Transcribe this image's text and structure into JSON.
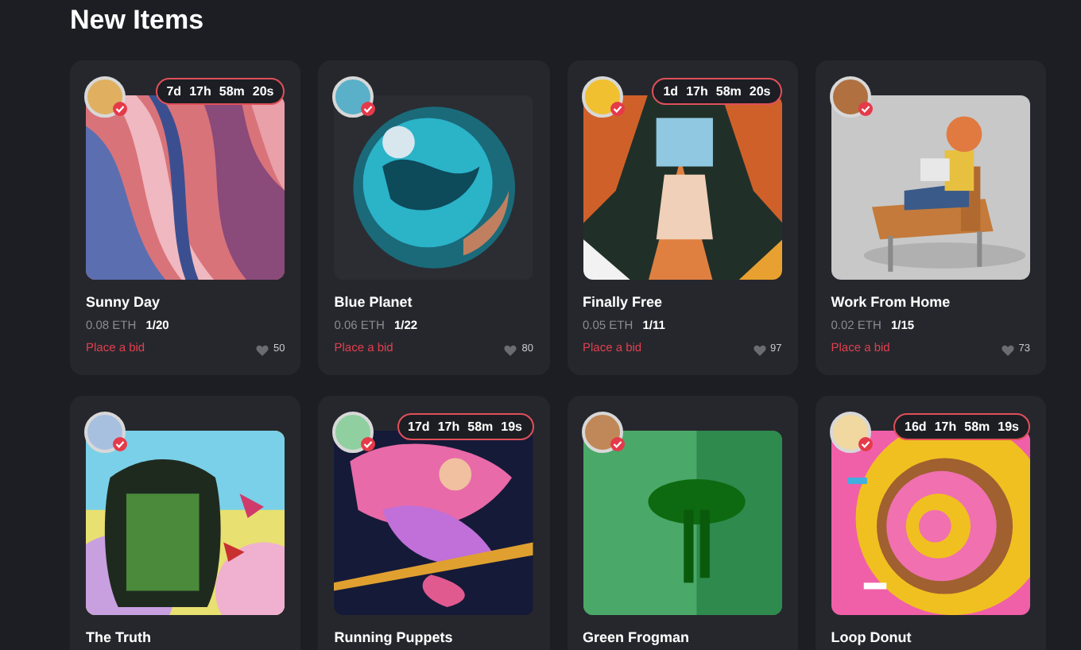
{
  "heading": "New Items",
  "items": [
    {
      "title": "Sunny Day",
      "timer": [
        "7d",
        "17h",
        "58m",
        "20s"
      ],
      "price": "0.08 ETH",
      "edition": "1/20",
      "action": "Place a bid",
      "likes": "50"
    },
    {
      "title": "Blue Planet",
      "price": "0.06 ETH",
      "edition": "1/22",
      "action": "Place a bid",
      "likes": "80"
    },
    {
      "title": "Finally Free",
      "timer": [
        "1d",
        "17h",
        "58m",
        "20s"
      ],
      "price": "0.05 ETH",
      "edition": "1/11",
      "action": "Place a bid",
      "likes": "97"
    },
    {
      "title": "Work From Home",
      "price": "0.02 ETH",
      "edition": "1/15",
      "action": "Place a bid",
      "likes": "73"
    },
    {
      "title": "The Truth"
    },
    {
      "title": "Running Puppets",
      "timer": [
        "17d",
        "17h",
        "58m",
        "19s"
      ]
    },
    {
      "title": "Green Frogman"
    },
    {
      "title": "Loop Donut",
      "timer": [
        "16d",
        "17h",
        "58m",
        "19s"
      ]
    }
  ]
}
